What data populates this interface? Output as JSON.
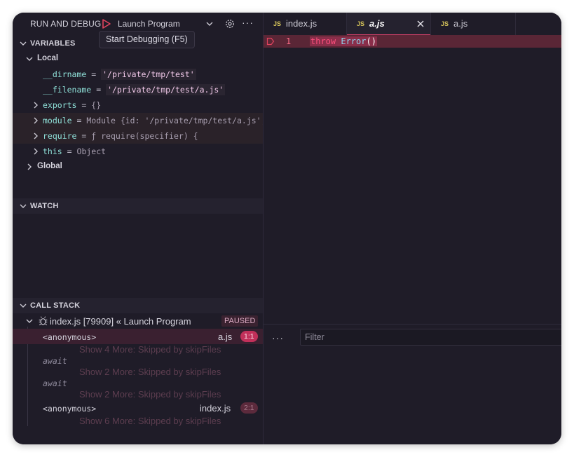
{
  "header": {
    "title": "RUN AND DEBUG",
    "config": "Launch Program",
    "tooltip": "Start Debugging (F5)"
  },
  "variables": {
    "section": "VARIABLES",
    "local_label": "Local",
    "items": [
      {
        "name": "__dirname",
        "eq": "=",
        "value": "'/private/tmp/test'"
      },
      {
        "name": "__filename",
        "eq": "=",
        "value": "'/private/tmp/test/a.js'"
      },
      {
        "name": "exports",
        "eq": "=",
        "value": "{}"
      },
      {
        "name": "module",
        "eq": "=",
        "value": "Module {id: '/private/tmp/test/a.js',…"
      },
      {
        "name": "require",
        "eq": "=",
        "value": "ƒ require(specifier) {"
      },
      {
        "name": "this",
        "eq": "=",
        "value": "Object"
      }
    ],
    "global_label": "Global"
  },
  "watch": {
    "section": "WATCH"
  },
  "call_stack": {
    "section": "CALL STACK",
    "session": "index.js [79909] « Launch Program",
    "status": "PAUSED",
    "frames": [
      {
        "name": "<anonymous>",
        "file": "a.js",
        "loc": "1:1"
      },
      {
        "name": "<anonymous>",
        "file": "index.js",
        "loc": "2:1"
      }
    ],
    "skipped": [
      "Show 4 More: Skipped by skipFiles",
      "Show 2 More: Skipped by skipFiles",
      "Show 2 More: Skipped by skipFiles",
      "Show 6 More: Skipped by skipFiles"
    ],
    "await_label": "await"
  },
  "editor": {
    "tabs": [
      {
        "icon": "JS",
        "label": "index.js"
      },
      {
        "icon": "JS",
        "label": "a.js"
      },
      {
        "icon": "JS",
        "label": "a.js"
      }
    ],
    "line_number": "1",
    "code": {
      "keyword": "throw",
      "fn": "Error",
      "parens": "()"
    }
  },
  "panel": {
    "more": "···",
    "filter_placeholder": "Filter"
  },
  "colors": {
    "background": "#1f1c28",
    "accent": "#d8426c",
    "error_line": "#5a2636"
  }
}
